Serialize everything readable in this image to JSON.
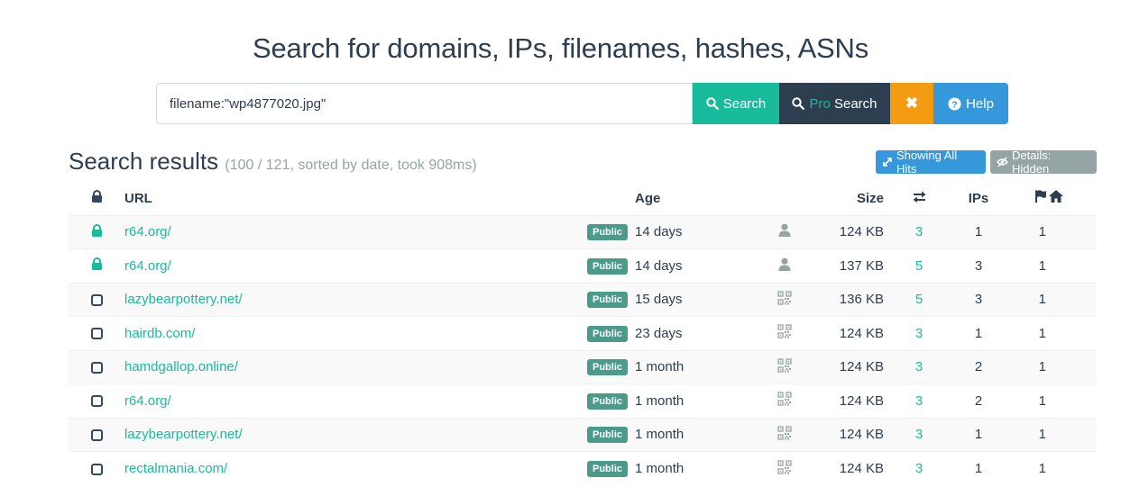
{
  "headline": "Search for domains, IPs, filenames, hashes, ASNs",
  "search": {
    "value": "filename:\"wp4877020.jpg\"",
    "search_label": "Search",
    "pro_prefix": "Pro",
    "pro_label": "Search",
    "clear_label": "✖",
    "help_label": "Help"
  },
  "results": {
    "title": "Search results",
    "meta": "(100 / 121, sorted by date, took 908ms)",
    "showing_all_hits": "Showing All Hits",
    "details_hidden": "Details: Hidden"
  },
  "columns": {
    "url": "URL",
    "age": "Age",
    "size": "Size",
    "ips": "IPs"
  },
  "colors": {
    "teal": "#18bc9c",
    "navy": "#2c3e50",
    "orange": "#f39c12",
    "blue": "#3498db",
    "gray": "#95a5a6"
  },
  "rows": [
    {
      "url": "r64.org/",
      "visibility": "Public",
      "age": "14 days",
      "submitter": "user-icon",
      "size": "124 KB",
      "transactions": "3",
      "ips": "1",
      "countries": "1",
      "secure": true
    },
    {
      "url": "r64.org/",
      "visibility": "Public",
      "age": "14 days",
      "submitter": "user-icon",
      "size": "137 KB",
      "transactions": "5",
      "ips": "3",
      "countries": "1",
      "secure": true
    },
    {
      "url": "lazybearpottery.net/",
      "visibility": "Public",
      "age": "15 days",
      "submitter": "qrcode-icon",
      "size": "136 KB",
      "transactions": "5",
      "ips": "3",
      "countries": "1",
      "secure": false
    },
    {
      "url": "hairdb.com/",
      "visibility": "Public",
      "age": "23 days",
      "submitter": "qrcode-icon",
      "size": "124 KB",
      "transactions": "3",
      "ips": "1",
      "countries": "1",
      "secure": false
    },
    {
      "url": "hamdgallop.online/",
      "visibility": "Public",
      "age": "1 month",
      "submitter": "qrcode-icon",
      "size": "124 KB",
      "transactions": "3",
      "ips": "2",
      "countries": "1",
      "secure": false
    },
    {
      "url": "r64.org/",
      "visibility": "Public",
      "age": "1 month",
      "submitter": "qrcode-icon",
      "size": "124 KB",
      "transactions": "3",
      "ips": "2",
      "countries": "1",
      "secure": false
    },
    {
      "url": "lazybearpottery.net/",
      "visibility": "Public",
      "age": "1 month",
      "submitter": "qrcode-icon",
      "size": "124 KB",
      "transactions": "3",
      "ips": "1",
      "countries": "1",
      "secure": false
    },
    {
      "url": "rectalmania.com/",
      "visibility": "Public",
      "age": "1 month",
      "submitter": "qrcode-icon",
      "size": "124 KB",
      "transactions": "3",
      "ips": "1",
      "countries": "1",
      "secure": false
    }
  ]
}
